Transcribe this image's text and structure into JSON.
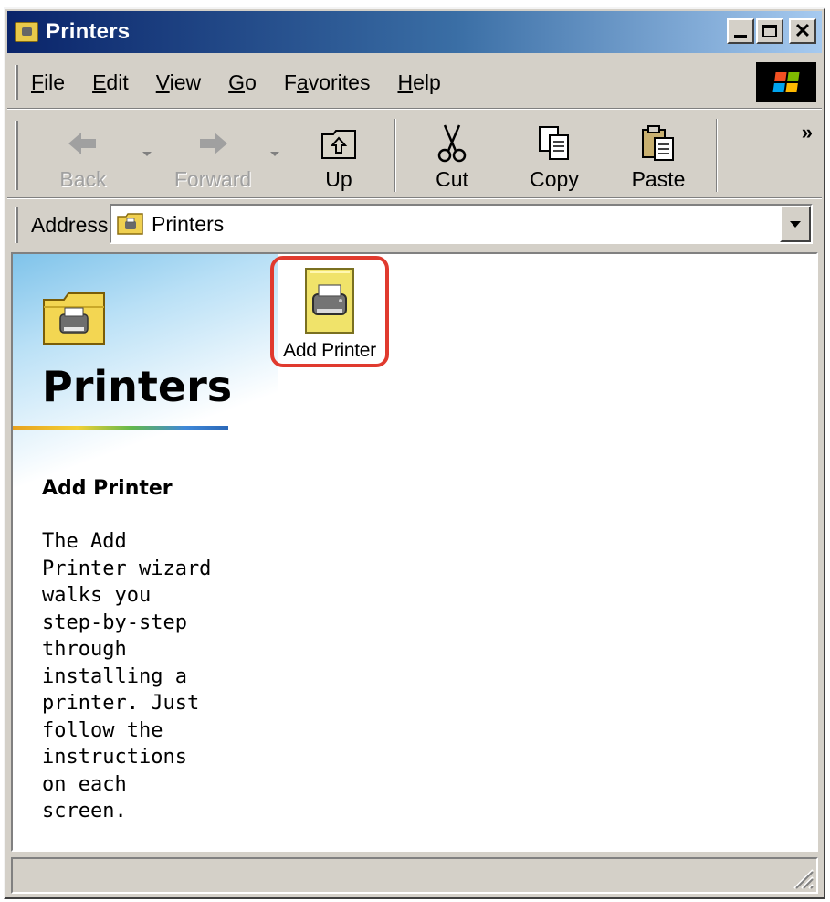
{
  "window": {
    "title": "Printers"
  },
  "menu": {
    "items": [
      "File",
      "Edit",
      "View",
      "Go",
      "Favorites",
      "Help"
    ]
  },
  "toolbar": {
    "back": "Back",
    "forward": "Forward",
    "up": "Up",
    "cut": "Cut",
    "copy": "Copy",
    "paste": "Paste",
    "more": "»"
  },
  "address": {
    "label": "Address",
    "value": "Printers"
  },
  "webview": {
    "title": "Printers",
    "subtitle": "Add Printer",
    "description": "The Add\nPrinter wizard\nwalks you\nstep-by-step\nthrough\ninstalling a\nprinter. Just\nfollow the\ninstructions\non each\nscreen."
  },
  "files": [
    {
      "label": "Add Printer",
      "icon": "add-printer-icon"
    }
  ],
  "status": {
    "text": ""
  },
  "colors": {
    "title_gradient_start": "#0a246a",
    "title_gradient_end": "#a6caf0",
    "highlight": "#e03a2e",
    "chrome": "#d4d0c8"
  }
}
